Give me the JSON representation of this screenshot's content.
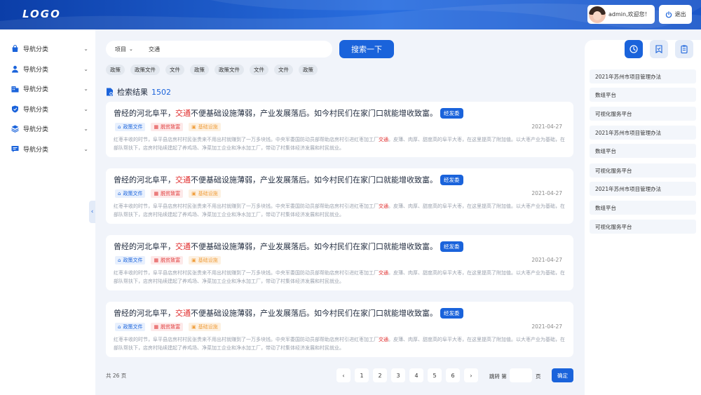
{
  "header": {
    "logo": "LOGO",
    "user_name": "admin,欢迎您！",
    "logout_label": "退出"
  },
  "sidebar": {
    "items": [
      {
        "label": "导航分类",
        "icon": "bag-icon"
      },
      {
        "label": "导航分类",
        "icon": "user-icon"
      },
      {
        "label": "导航分类",
        "icon": "building-icon"
      },
      {
        "label": "导航分类",
        "icon": "shield-icon"
      },
      {
        "label": "导航分类",
        "icon": "layers-icon"
      },
      {
        "label": "导航分类",
        "icon": "message-icon"
      }
    ],
    "collapse_glyph": "‹"
  },
  "search": {
    "type_label": "项目",
    "query": "交通",
    "button_label": "搜索一下",
    "tags": [
      "政策",
      "政策文件",
      "文件",
      "政策",
      "政策文件",
      "文件",
      "文件",
      "政策"
    ]
  },
  "results": {
    "label": "检索结果",
    "count": "1502",
    "items": [
      {
        "title_pre": "曾经的河北阜平，",
        "title_hl": "交通",
        "title_post": "不便基础设施薄弱，产业发展落后。如今村民们在家门口就能增收致富。",
        "badge": "经发委",
        "tags": [
          "政策文件",
          "脱贫致富",
          "基础设施"
        ],
        "date": "2021-04-27",
        "desc_pre": "红枣丰收的时节，阜平县店房村村民张贵来不用出村就赚到了一万多块钱。中央军委国防动员部帮助店房村引进红枣加工厂",
        "desc_hl": "交通",
        "desc_post": "。皮薄、肉厚、甜度高的阜平大枣，在这里提高了附加值。以大枣产业为基础，在部队帮扶下，店房村陆续建起了养鸡场、净菜加工企业和净水加工厂，带动了村集体经济发展和村民就业。"
      },
      {
        "title_pre": "曾经的河北阜平，",
        "title_hl": "交通",
        "title_post": "不便基础设施薄弱，产业发展落后。如今村民们在家门口就能增收致富。",
        "badge": "经发委",
        "tags": [
          "政策文件",
          "脱贫致富",
          "基础设施"
        ],
        "date": "2021-04-27",
        "desc_pre": "红枣丰收的时节，阜平县店房村村民张贵来不用出村就赚到了一万多块钱。中央军委国防动员部帮助店房村引进红枣加工厂",
        "desc_hl": "交通",
        "desc_post": "。皮薄、肉厚、甜度高的阜平大枣，在这里提高了附加值。以大枣产业为基础，在部队帮扶下，店房村陆续建起了养鸡场、净菜加工企业和净水加工厂，带动了村集体经济发展和村民就业。"
      },
      {
        "title_pre": "曾经的河北阜平，",
        "title_hl": "交通",
        "title_post": "不便基础设施薄弱，产业发展落后。如今村民们在家门口就能增收致富。",
        "badge": "经发委",
        "tags": [
          "政策文件",
          "脱贫致富",
          "基础设施"
        ],
        "date": "2021-04-27",
        "desc_pre": "红枣丰收的时节，阜平县店房村村民张贵来不用出村就赚到了一万多块钱。中央军委国防动员部帮助店房村引进红枣加工厂",
        "desc_hl": "交通",
        "desc_post": "。皮薄、肉厚、甜度高的阜平大枣，在这里提高了附加值。以大枣产业为基础，在部队帮扶下，店房村陆续建起了养鸡场、净菜加工企业和净水加工厂，带动了村集体经济发展和村民就业。"
      },
      {
        "title_pre": "曾经的河北阜平，",
        "title_hl": "交通",
        "title_post": "不便基础设施薄弱，产业发展落后。如今村民们在家门口就能增收致富。",
        "badge": "经发委",
        "tags": [
          "政策文件",
          "脱贫致富",
          "基础设施"
        ],
        "date": "2021-04-27",
        "desc_pre": "红枣丰收的时节，阜平县店房村村民张贵来不用出村就赚到了一万多块钱。中央军委国防动员部帮助店房村引进红枣加工厂",
        "desc_hl": "交通",
        "desc_post": "。皮薄、肉厚、甜度高的阜平大枣，在这里提高了附加值。以大枣产业为基础，在部队帮扶下，店房村陆续建起了养鸡场、净菜加工企业和净水加工厂，带动了村集体经济发展和村民就业。"
      }
    ]
  },
  "pagination": {
    "total": "共 26 页",
    "prev": "‹",
    "next": "›",
    "pages": [
      "1",
      "2",
      "3",
      "4",
      "5",
      "6"
    ],
    "jump_label": "跳转 第",
    "page_unit": "页",
    "confirm_label": "确定"
  },
  "right_panel": {
    "icons": [
      "clock-icon",
      "bookmark-icon",
      "clipboard-icon"
    ],
    "items": [
      "2021年苏州市项目管理办法",
      "数组平台",
      "可视化服务平台",
      "2021年苏州市项目管理办法",
      "数组平台",
      "可视化服务平台",
      "2021年苏州市项目管理办法",
      "数组平台",
      "可视化服务平台"
    ]
  },
  "colors": {
    "primary": "#1a63db",
    "highlight": "#e02c2c",
    "header_dark": "#0b3ea8"
  }
}
